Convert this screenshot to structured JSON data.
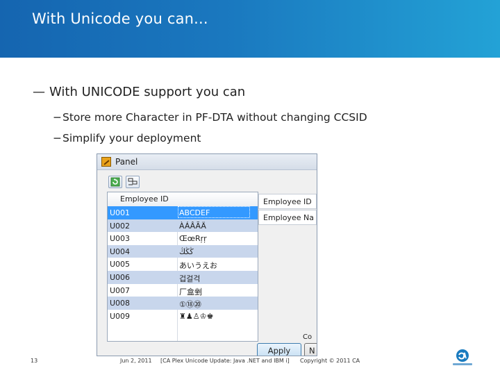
{
  "slide": {
    "title": "With Unicode you can...",
    "bullet": "With UNICODE support you can",
    "subbullets": [
      "Store more Character in PF-DTA without changing CCSID",
      "Simplify your deployment"
    ]
  },
  "panel": {
    "title": "Panel",
    "toolbar": [
      "refresh-icon",
      "grid-view-icon"
    ],
    "grid": {
      "columns": [
        "Employee ID",
        ""
      ],
      "selected_index": 0,
      "rows": [
        {
          "id": "U001",
          "name": "ABCDEF"
        },
        {
          "id": "U002",
          "name": "ÀÁÂÃÄ"
        },
        {
          "id": "U003",
          "name": "ŒœRŗŗ"
        },
        {
          "id": "U004",
          "name": "ڭڭڭ"
        },
        {
          "id": "U005",
          "name": "あいうえお"
        },
        {
          "id": "U006",
          "name": "겁걸걱"
        },
        {
          "id": "U007",
          "name": "厂盒剉"
        },
        {
          "id": "U008",
          "name": "①⑱⑳"
        },
        {
          "id": "U009",
          "name": "♜♟♙♔♚"
        }
      ]
    },
    "form": {
      "labels": [
        "Employee ID",
        "Employee Na"
      ],
      "cor_label": "Co",
      "apply_label": "Apply",
      "n_label": "N"
    }
  },
  "footer": {
    "page": "13",
    "date": "Jun 2, 2011",
    "doc": "[CA Plex Unicode Update: Java .NET and IBM i]",
    "copyright": "Copyright © 2011 CA"
  },
  "colors": {
    "banner_start": "#1565b0",
    "banner_end": "#23a2d6",
    "row_alt": "#c8d6ec",
    "row_selected": "#3399ff"
  }
}
